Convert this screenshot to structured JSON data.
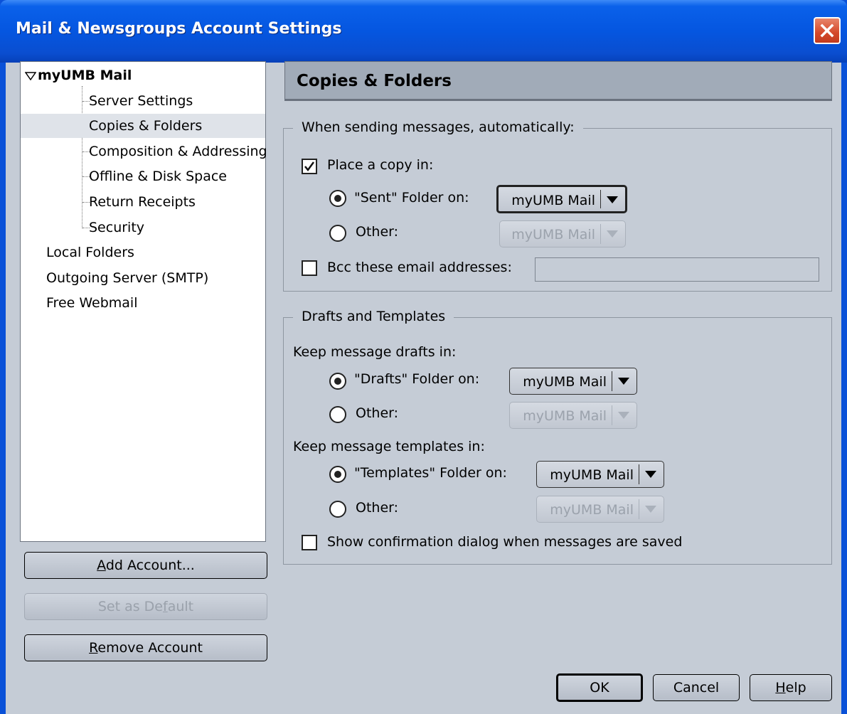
{
  "window": {
    "title": "Mail & Newsgroups Account Settings"
  },
  "tree": {
    "root": "myUMB Mail",
    "children": [
      "Server Settings",
      "Copies & Folders",
      "Composition & Addressing",
      "Offline & Disk Space",
      "Return Receipts",
      "Security"
    ],
    "accounts": [
      "Local Folders",
      "Outgoing Server (SMTP)",
      "Free Webmail"
    ],
    "selected": "Copies & Folders"
  },
  "buttons": {
    "add_account": {
      "prefix": "",
      "u": "A",
      "rest": "dd Account..."
    },
    "set_default": {
      "prefix": "Set as De",
      "u": "f",
      "rest": "ault"
    },
    "remove_account": {
      "prefix": "",
      "u": "R",
      "rest": "emove Account"
    },
    "ok": "OK",
    "cancel": "Cancel",
    "help": {
      "u": "H",
      "rest": "elp"
    }
  },
  "panel": {
    "title": "Copies & Folders",
    "sending": {
      "legend": "When sending messages, automatically:",
      "place_copy": {
        "label": "Place a copy in:",
        "checked": true
      },
      "sent_folder": {
        "label": "\"Sent\" Folder on:",
        "selected": true,
        "value": "myUMB Mail"
      },
      "other": {
        "label": "Other:",
        "selected": false,
        "value": "myUMB Mail"
      },
      "bcc": {
        "label": "Bcc these email addresses:",
        "checked": false,
        "value": ""
      }
    },
    "drafts": {
      "legend": "Drafts and Templates",
      "drafts_heading": "Keep message drafts in:",
      "drafts_folder": {
        "label": "\"Drafts\" Folder on:",
        "selected": true,
        "value": "myUMB Mail"
      },
      "drafts_other": {
        "label": "Other:",
        "selected": false,
        "value": "myUMB Mail"
      },
      "templates_heading": "Keep message templates in:",
      "templates_folder": {
        "label": "\"Templates\" Folder on:",
        "selected": true,
        "value": "myUMB Mail"
      },
      "templates_other": {
        "label": "Other:",
        "selected": false,
        "value": "myUMB Mail"
      },
      "confirm": {
        "label": "Show confirmation dialog when messages are saved",
        "checked": false
      }
    }
  },
  "colors": {
    "titlebar": "#0556e0",
    "client": "#c5ccd6",
    "header": "#a1abb8",
    "selection": "#dfe3e9"
  }
}
